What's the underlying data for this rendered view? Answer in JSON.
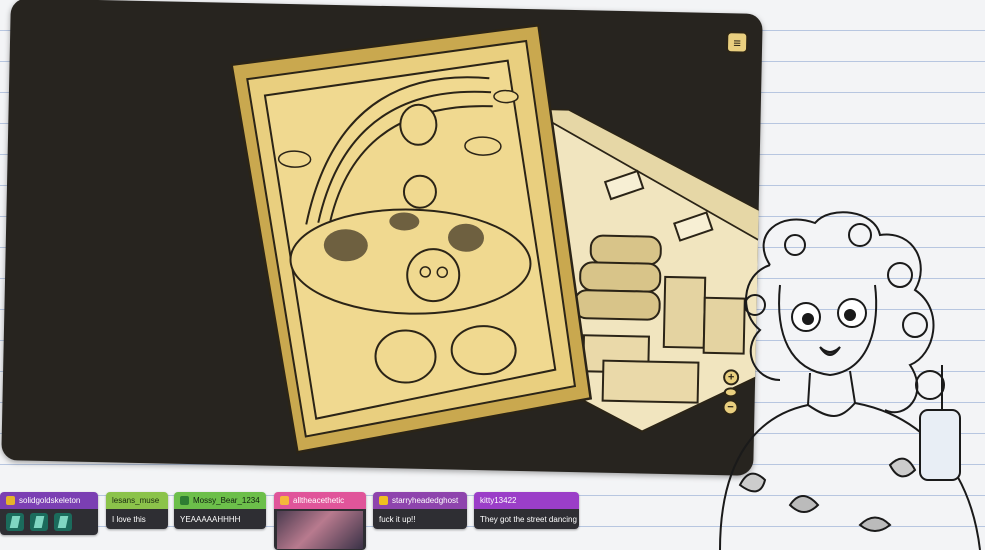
{
  "game": {
    "menu_icon": "menu-icon",
    "zoom_in_label": "+",
    "zoom_out_label": "−",
    "eye_icon": "eye-icon"
  },
  "colors": {
    "frame": "#e9cf7f",
    "frame_shadow": "#c9a84f",
    "room_floor": "#f1e5bf",
    "ink": "#2b2417",
    "background_dark": "#27241f"
  },
  "chat": {
    "messages": [
      {
        "username": "solidgoldskeleton",
        "message": "",
        "header_color": "#7b3fb3",
        "badge_color": "#e6b32a",
        "type": "emotes"
      },
      {
        "username": "lesans_muse",
        "message": "I love this",
        "header_color": "#8bc34a",
        "badge_color": "",
        "type": "text"
      },
      {
        "username": "Mossy_Bear_1234",
        "message": "YEAAAAAHHHH",
        "header_color": "#6cbf4a",
        "badge_color": "#2e7d32",
        "type": "text"
      },
      {
        "username": "alltheacethetic",
        "message": "",
        "header_color": "#e0559a",
        "badge_color": "#f5b83b",
        "type": "image"
      },
      {
        "username": "starryheadedghost",
        "message": "fuck it up!!",
        "header_color": "#8e44ad",
        "badge_color": "#f0c020",
        "type": "text"
      },
      {
        "username": "kitty13422",
        "message": "They got the street dancing",
        "header_color": "#9b3ec8",
        "badge_color": "",
        "type": "text"
      }
    ]
  }
}
